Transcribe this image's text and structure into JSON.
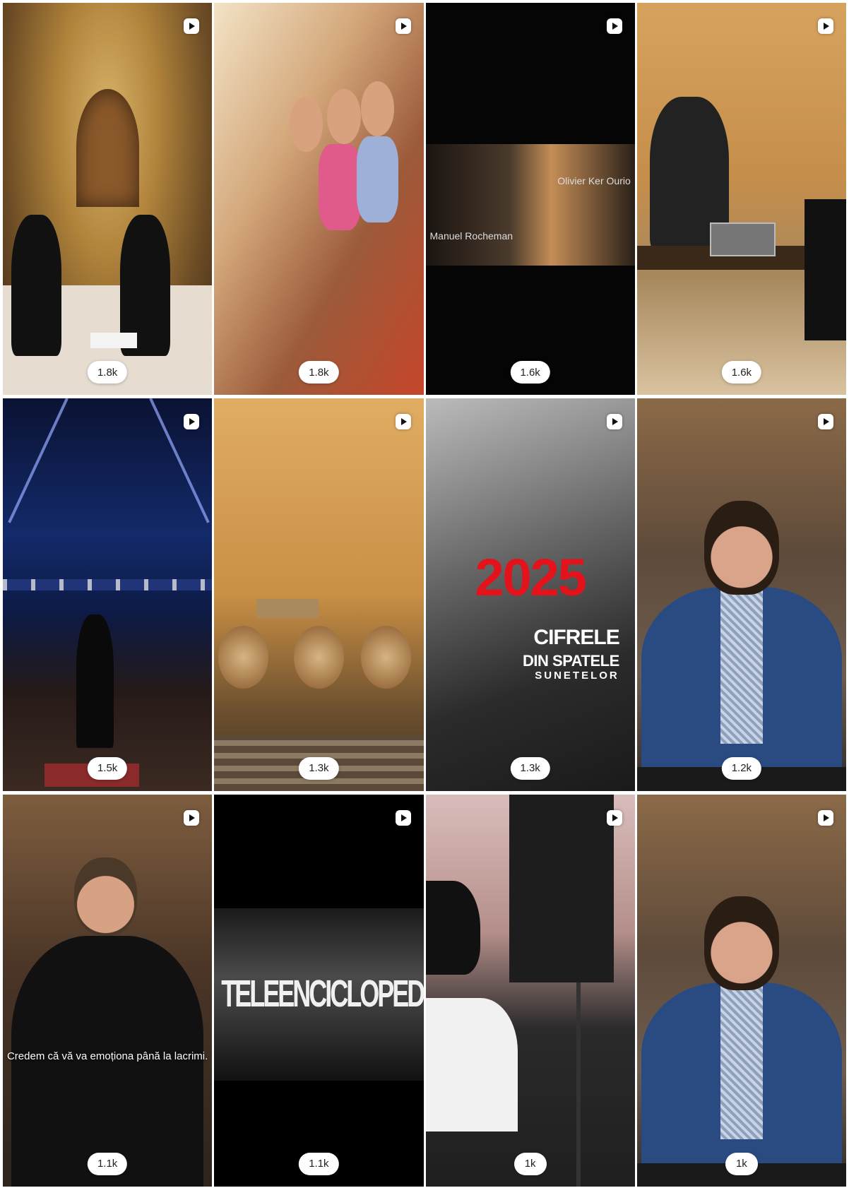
{
  "grid": {
    "tiles": [
      {
        "views": "1.8k",
        "scene": "church",
        "reel_icon": "play-reel-icon"
      },
      {
        "views": "1.8k",
        "scene": "choir",
        "reel_icon": "play-reel-icon"
      },
      {
        "views": "1.6k",
        "scene": "dark-piano",
        "reel_icon": "play-reel-icon",
        "captions": [
          "Olivier Ker Ourio",
          "Manuel Rocheman"
        ]
      },
      {
        "views": "1.6k",
        "scene": "studio",
        "reel_icon": "play-reel-icon"
      },
      {
        "views": "1.5k",
        "scene": "concert-hall",
        "reel_icon": "play-reel-icon"
      },
      {
        "views": "1.3k",
        "scene": "orchestra",
        "reel_icon": "play-reel-icon"
      },
      {
        "views": "1.3k",
        "scene": "bw-violins",
        "reel_icon": "play-reel-icon",
        "overlay": {
          "year": "2025",
          "line1": "CIFRELE",
          "line2": "DIN SPATELE",
          "line3": "SUNETELOR"
        }
      },
      {
        "views": "1.2k",
        "scene": "speaker",
        "reel_icon": "play-reel-icon"
      },
      {
        "views": "1.1k",
        "scene": "man-speaking",
        "reel_icon": "play-reel-icon",
        "subtitle": "Credem că vă va emoționa până la lacrimi."
      },
      {
        "views": "1.1k",
        "scene": "teleenciclopedia",
        "reel_icon": "play-reel-icon",
        "title": "TELEENCICLOPEDIA"
      },
      {
        "views": "1k",
        "scene": "woman",
        "reel_icon": "play-reel-icon"
      },
      {
        "views": "1k",
        "scene": "speaker",
        "reel_icon": "play-reel-icon"
      }
    ]
  }
}
